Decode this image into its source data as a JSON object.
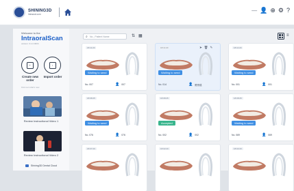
{
  "brand": {
    "name": "SHINING3D",
    "sub": "Intraoral.com"
  },
  "topbar": {
    "icons": [
      "minimize-icon",
      "user-icon",
      "globe-icon",
      "settings-icon",
      "help-icon"
    ],
    "min_glyph": "—",
    "user_glyph": "👤",
    "globe_glyph": "⊕",
    "gear_glyph": "⚙",
    "help_glyph": "?"
  },
  "sidebar": {
    "welcome": "Welcome to the",
    "app_name": "IntraoralScan",
    "version": "version: 3.1.0.0004",
    "create_label": "Create new order",
    "import_label": "Import order",
    "hint": "Find out what's new",
    "videos": [
      {
        "label": "Review Instructional Video 1"
      },
      {
        "label": "Review Instructional Video 2"
      }
    ],
    "cloud_label": "Shining3D Dental Cloud"
  },
  "toolbar": {
    "search_placeholder": "No., Patient Name"
  },
  "cards": [
    {
      "date": "18:11:20",
      "status": "Waiting to send",
      "status_type": "wait",
      "no": "No. 007",
      "patient": "007",
      "selected": false
    },
    {
      "date": "18:11:20",
      "status": "Waiting to send",
      "status_type": "wait",
      "no": "No. 014",
      "patient": "陈宗成",
      "selected": true
    },
    {
      "date": "18:11:20",
      "status": "Waiting to send",
      "status_type": "wait",
      "no": "No. 001",
      "patient": "001",
      "selected": false
    },
    {
      "date": "18:08:25",
      "status": "Waiting to send",
      "status_type": "wait",
      "no": "No. 076",
      "patient": "076",
      "selected": false
    },
    {
      "date": "18:08:25",
      "status": "Accepted",
      "status_type": "acc",
      "no": "No. 002",
      "patient": "002",
      "selected": false
    },
    {
      "date": "18:08:25",
      "status": "Waiting to send",
      "status_type": "wait",
      "no": "No. 069",
      "patient": "069",
      "selected": false
    },
    {
      "date": "18:07:20",
      "status": "",
      "status_type": "none",
      "no": "",
      "patient": "",
      "selected": false
    },
    {
      "date": "18:02:20",
      "status": "",
      "status_type": "none",
      "no": "",
      "patient": "",
      "selected": false
    },
    {
      "date": "18:02:20",
      "status": "",
      "status_type": "none",
      "no": "",
      "patient": "",
      "selected": false
    }
  ]
}
